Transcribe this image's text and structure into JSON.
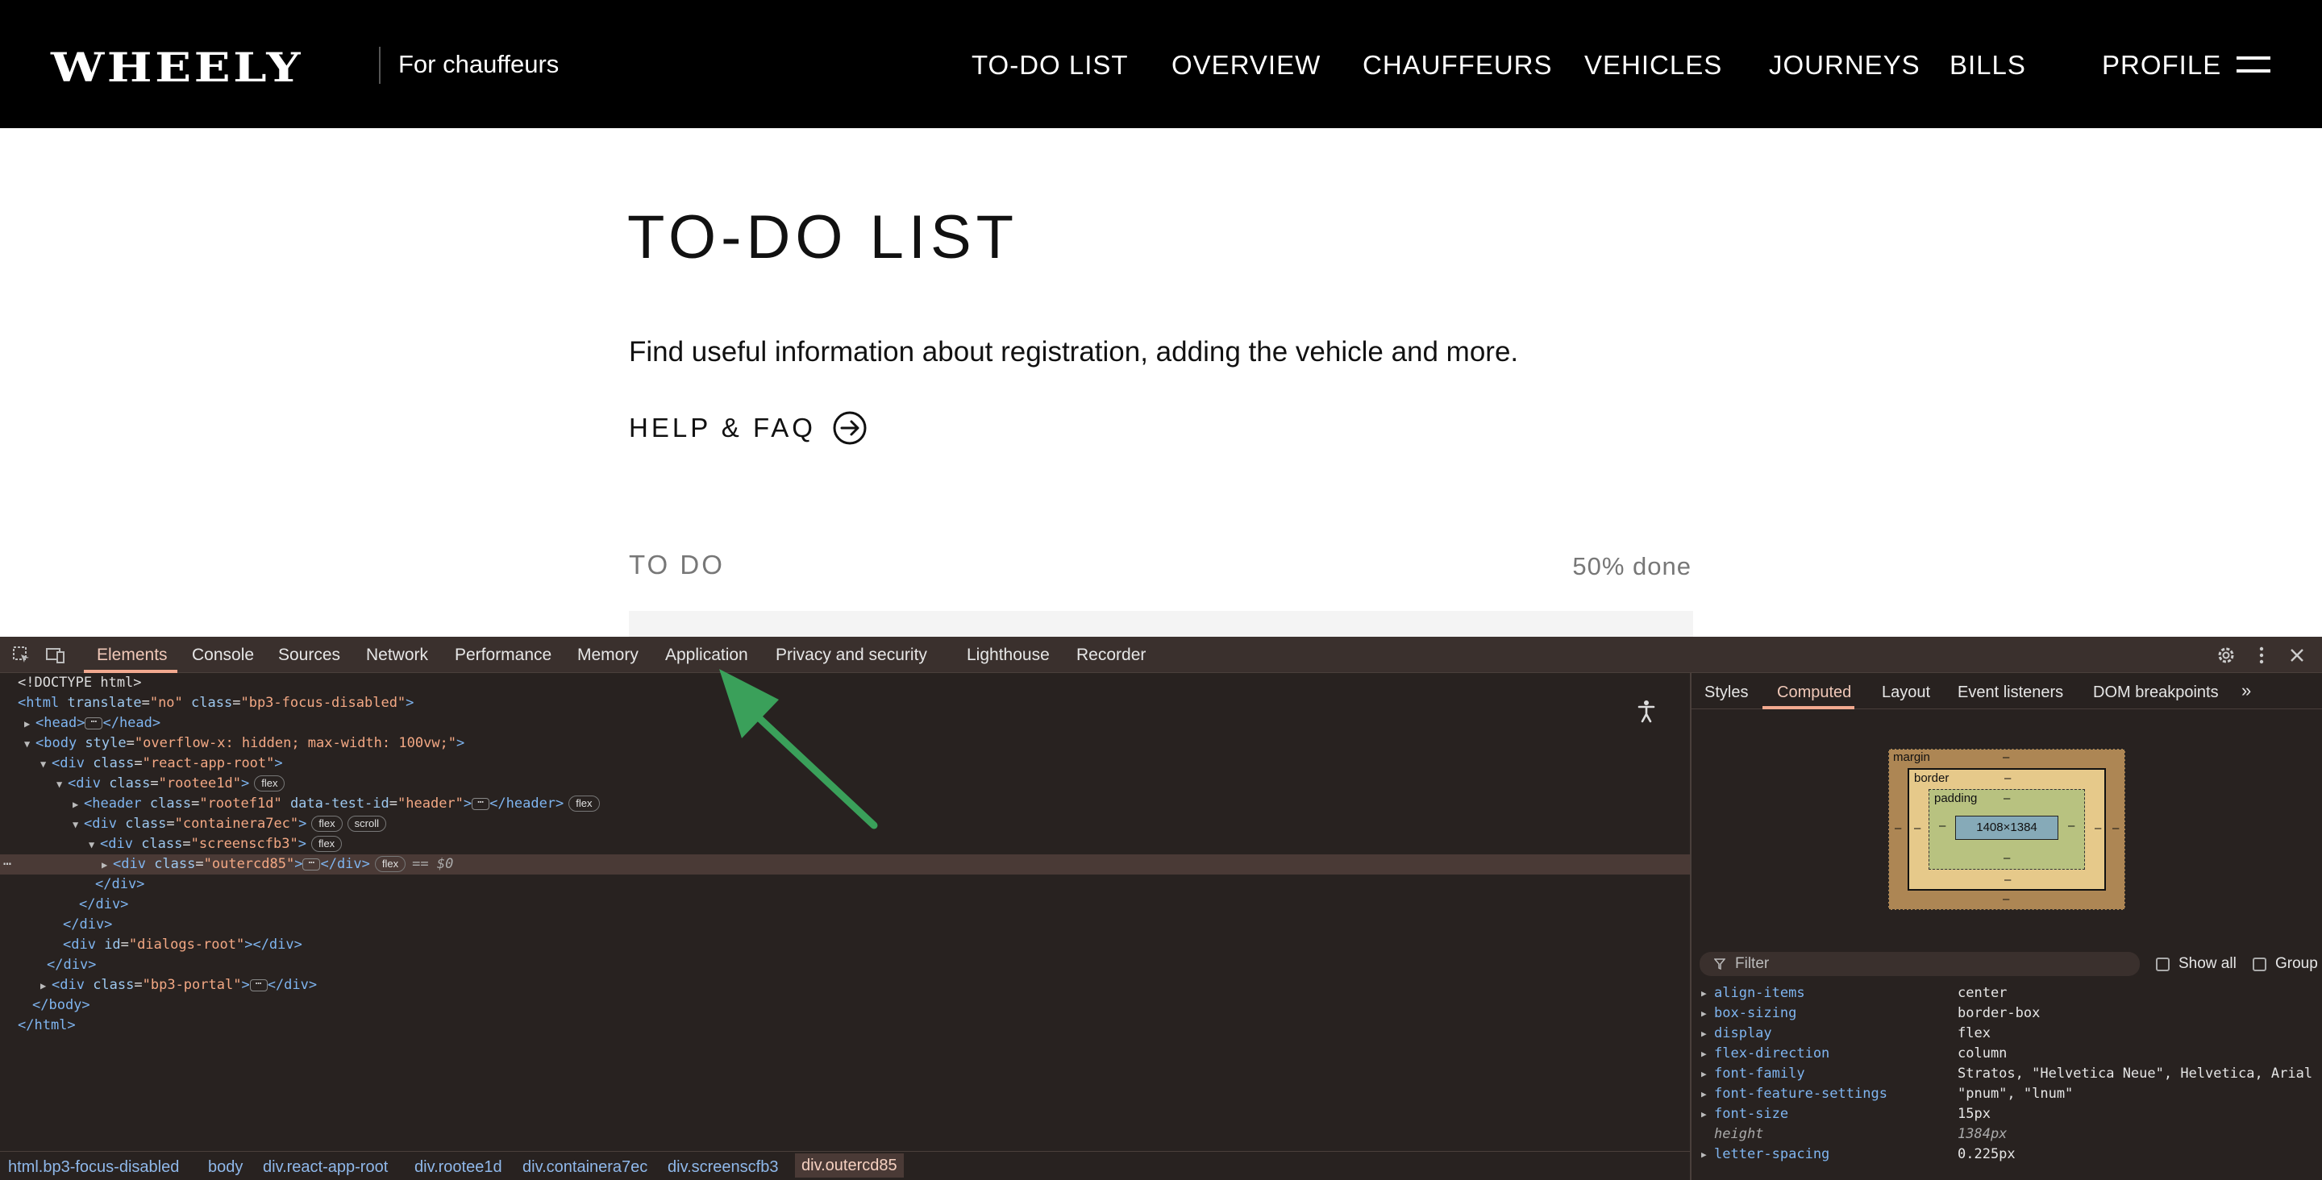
{
  "site": {
    "logo": "WHEELY",
    "tagline": "For chauffeurs",
    "nav": [
      "TO-DO LIST",
      "OVERVIEW",
      "CHAUFFEURS",
      "VEHICLES",
      "JOURNEYS",
      "BILLS",
      "PROFILE"
    ],
    "page_title": "TO-DO LIST",
    "intro": "Find useful information about registration, adding the vehicle and more.",
    "help_link": "HELP & FAQ",
    "todo_heading": "TO DO",
    "todo_progress": "50% done"
  },
  "devtools": {
    "tabs": [
      "Elements",
      "Console",
      "Sources",
      "Network",
      "Performance",
      "Memory",
      "Application",
      "Privacy and security",
      "Lighthouse",
      "Recorder"
    ],
    "active_tab": "Elements",
    "dom": {
      "doctype": "<!DOCTYPE html>",
      "html_tag": "html",
      "html_attr1": "translate",
      "html_val1": "\"no\"",
      "html_attr2": "class",
      "html_val2": "\"bp3-focus-disabled\"",
      "head": "head",
      "body_attr": "style",
      "body_val": "\"overflow-x: hidden; max-width: 100vw;\"",
      "react_root_val": "\"react-app-root\"",
      "rootee_val": "\"rootee1d\"",
      "header_class_val": "\"rootef1d\"",
      "header_testid_attr": "data-test-id",
      "header_testid_val": "\"header\"",
      "container_val": "\"containera7ec\"",
      "screen_val": "\"screenscfb3\"",
      "outer_val": "\"outercd85\"",
      "dialogs_attr": "id",
      "dialogs_val": "\"dialogs-root\"",
      "portal_val": "\"bp3-portal\"",
      "badge_flex": "flex",
      "badge_scroll": "scroll",
      "selected_marker": "== $0"
    },
    "breadcrumbs": [
      "html.bp3-focus-disabled",
      "body",
      "div.react-app-root",
      "div.rootee1d",
      "div.containera7ec",
      "div.screenscfb3",
      "div.outercd85"
    ],
    "side_tabs": [
      "Styles",
      "Computed",
      "Layout",
      "Event listeners",
      "DOM breakpoints"
    ],
    "active_side_tab": "Computed",
    "box_model": {
      "margin": "margin",
      "border": "border",
      "padding": "padding",
      "content": "1408×1384",
      "dash": "–"
    },
    "filter_placeholder": "Filter",
    "show_all": "Show all",
    "group": "Group",
    "computed": [
      {
        "name": "align-items",
        "value": "center"
      },
      {
        "name": "box-sizing",
        "value": "border-box"
      },
      {
        "name": "display",
        "value": "flex"
      },
      {
        "name": "flex-direction",
        "value": "column"
      },
      {
        "name": "font-family",
        "value": "Stratos, \"Helvetica Neue\", Helvetica, Arial"
      },
      {
        "name": "font-feature-settings",
        "value": "\"pnum\", \"lnum\""
      },
      {
        "name": "font-size",
        "value": "15px"
      },
      {
        "name": "height",
        "value": "1384px",
        "sub": true
      },
      {
        "name": "letter-spacing",
        "value": "0.225px"
      }
    ]
  },
  "colors": {
    "header_bg": "#000000",
    "devtools_bg": "#282220",
    "accent_tab": "#f2a98f",
    "annotation_arrow": "#3aa05a"
  }
}
